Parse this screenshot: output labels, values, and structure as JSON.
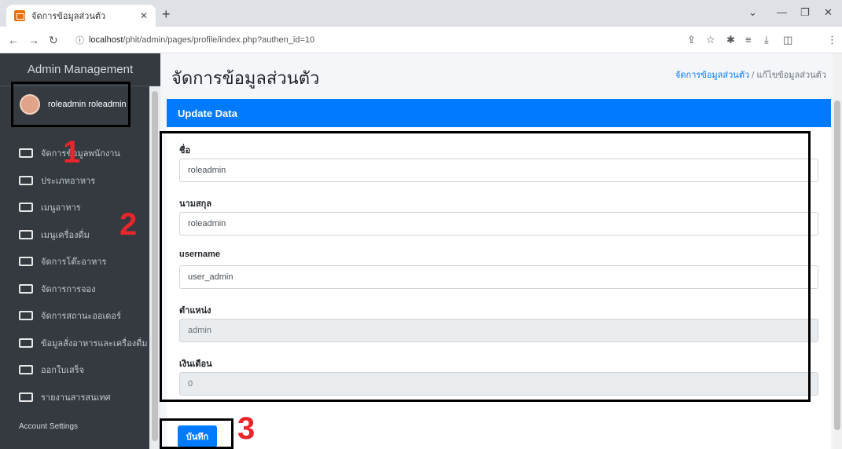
{
  "browser": {
    "tab_title": "จัดการข้อมูลส่วนตัว",
    "url_host": "localhost",
    "url_path": "/phit/admin/pages/profile/index.php?authen_id=10"
  },
  "sidebar": {
    "brand": "Admin Management",
    "user_name": "roleadmin roleadmin",
    "items": [
      {
        "label": "จัดการข้อมูลพนักงาน"
      },
      {
        "label": "ประเภทอาหาร"
      },
      {
        "label": "เมนูอาหาร"
      },
      {
        "label": "เมนูเครื่องดื่ม"
      },
      {
        "label": "จัดการโต๊ะอาหาร"
      },
      {
        "label": "จัดการการจอง"
      },
      {
        "label": "จัดการสถานะออเดอร์"
      },
      {
        "label": "ข้อมูลสั่งอาหารและเครื่องดื่ม"
      },
      {
        "label": "ออกใบเสร็จ"
      },
      {
        "label": "รายงานสารสนเทศ"
      }
    ],
    "account_header": "Account Settings"
  },
  "main": {
    "page_title": "จัดการข้อมูลส่วนตัว",
    "breadcrumb_link": "จัดการข้อมูลส่วนตัว",
    "breadcrumb_sep": "/",
    "breadcrumb_current": "แก้ไขข้อมูลส่วนตัว",
    "card_title": "Update Data",
    "fields": [
      {
        "label": "ชื่อ",
        "value": "roleadmin"
      },
      {
        "label": "นามสกุล",
        "value": "roleadmin"
      },
      {
        "label": "username",
        "value": "user_admin"
      },
      {
        "label": "ตำแหน่ง",
        "value": "admin"
      },
      {
        "label": "เงินเดือน",
        "value": "0"
      }
    ],
    "save_label": "บันทึก"
  },
  "annotations": {
    "n1": "1",
    "n2": "2",
    "n3": "3",
    "color": "#e8262b"
  },
  "colors": {
    "primary": "#007bff",
    "sidebar": "#343a40"
  }
}
